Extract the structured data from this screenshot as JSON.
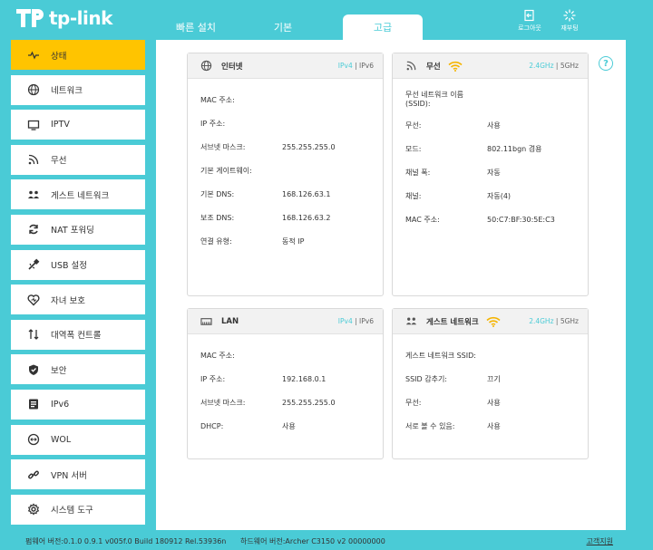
{
  "brand": {
    "name": "tp-link"
  },
  "tabs": [
    {
      "label": "빠른 설치"
    },
    {
      "label": "기본"
    },
    {
      "label": "고급"
    }
  ],
  "top_actions": {
    "logout": "로그아웃",
    "reboot": "재부팅"
  },
  "sidebar": {
    "items": [
      {
        "label": "상태",
        "icon": "pulse-icon"
      },
      {
        "label": "네트워크",
        "icon": "globe-icon"
      },
      {
        "label": "IPTV",
        "icon": "monitor-icon"
      },
      {
        "label": "무선",
        "icon": "wireless-icon"
      },
      {
        "label": "게스트 네트워크",
        "icon": "guest-icon"
      },
      {
        "label": "NAT 포워딩",
        "icon": "nat-icon"
      },
      {
        "label": "USB 설정",
        "icon": "usb-icon"
      },
      {
        "label": "자녀 보호",
        "icon": "heart-icon"
      },
      {
        "label": "대역폭 컨트롤",
        "icon": "bandwidth-icon"
      },
      {
        "label": "보안",
        "icon": "shield-icon"
      },
      {
        "label": "IPv6",
        "icon": "ipv6-icon"
      },
      {
        "label": "WOL",
        "icon": "wol-icon"
      },
      {
        "label": "VPN 서버",
        "icon": "vpn-icon"
      },
      {
        "label": "시스템 도구",
        "icon": "gear-icon"
      }
    ]
  },
  "help": "?",
  "cards": {
    "internet": {
      "title": "인터넷",
      "link_a": "IPv4",
      "sep": "|",
      "link_b": "IPv6",
      "rows": [
        {
          "label": "MAC 주소:",
          "value": ""
        },
        {
          "label": "IP 주소:",
          "value": ""
        },
        {
          "label": "서브넷 마스크:",
          "value": "255.255.255.0"
        },
        {
          "label": "기본 게이트웨이:",
          "value": ""
        },
        {
          "label": "기본 DNS:",
          "value": "168.126.63.1"
        },
        {
          "label": "보조 DNS:",
          "value": "168.126.63.2"
        },
        {
          "label": "연결 유형:",
          "value": "동적 IP"
        }
      ]
    },
    "wireless": {
      "title": "무선",
      "link_a": "2.4GHz",
      "sep": "|",
      "link_b": "5GHz",
      "ssid_label_1": "무선 네트워크 이름",
      "ssid_label_2": "(SSID):",
      "rows": [
        {
          "label": "무선:",
          "value": "사용"
        },
        {
          "label": "모드:",
          "value": "802.11bgn 겸용"
        },
        {
          "label": "채널 폭:",
          "value": "자동"
        },
        {
          "label": "채널:",
          "value": "자동(4)"
        },
        {
          "label": "MAC 주소:",
          "value": "50:C7:BF:30:5E:C3"
        }
      ]
    },
    "lan": {
      "title": "LAN",
      "link_a": "IPv4",
      "sep": "|",
      "link_b": "IPv6",
      "rows": [
        {
          "label": "MAC 주소:",
          "value": ""
        },
        {
          "label": "IP 주소:",
          "value": "192.168.0.1"
        },
        {
          "label": "서브넷 마스크:",
          "value": "255.255.255.0"
        },
        {
          "label": "DHCP:",
          "value": "사용"
        }
      ]
    },
    "guest": {
      "title": "게스트 네트워크",
      "link_a": "2.4GHz",
      "sep": "|",
      "link_b": "5GHz",
      "rows": [
        {
          "label": "게스트 네트워크 SSID:",
          "value": ""
        },
        {
          "label": "SSID 감추기:",
          "value": "끄기"
        },
        {
          "label": "무선:",
          "value": "사용"
        },
        {
          "label": "서로 볼 수 있음:",
          "value": "사용"
        }
      ]
    }
  },
  "footer": {
    "firmware": "펌웨어 버전:0.1.0 0.9.1 v005f.0 Build 180912 Rel.53936n",
    "hardware": "하드웨어 버전:Archer C3150 v2 00000000",
    "support": "고객지원"
  },
  "colors": {
    "accent": "#4acbd6",
    "active_nav": "#ffc400",
    "wifi": "#f5b400"
  }
}
